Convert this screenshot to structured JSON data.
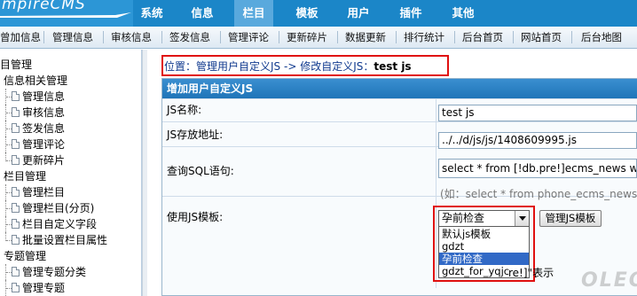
{
  "brand": {
    "logo_text": "mpireCMS"
  },
  "top_menu": [
    {
      "label": "系统"
    },
    {
      "label": "信息"
    },
    {
      "label": "栏目",
      "active": true
    },
    {
      "label": "模板"
    },
    {
      "label": "用户"
    },
    {
      "label": "插件"
    },
    {
      "label": "其他"
    }
  ],
  "toolbar": [
    {
      "label": "曾加信息"
    },
    {
      "label": "管理信息"
    },
    {
      "label": "审核信息"
    },
    {
      "label": "签发信息"
    },
    {
      "label": "管理评论"
    },
    {
      "label": "更新碎片"
    },
    {
      "label": "数据更新"
    },
    {
      "label": "排行统计"
    },
    {
      "label": "后台首页"
    },
    {
      "label": "网站首页"
    },
    {
      "label": "后台地图"
    }
  ],
  "sidebar": {
    "groups": [
      {
        "label": "目管理",
        "items": []
      },
      {
        "label": "信息相关管理",
        "items": [
          {
            "label": "管理信息"
          },
          {
            "label": "审核信息"
          },
          {
            "label": "签发信息"
          },
          {
            "label": "管理评论"
          },
          {
            "label": "更新碎片"
          }
        ]
      },
      {
        "label": "栏目管理",
        "items": [
          {
            "label": "管理栏目"
          },
          {
            "label": "管理栏目(分页)"
          },
          {
            "label": "栏目自定义字段"
          },
          {
            "label": "批量设置栏目属性"
          }
        ]
      },
      {
        "label": "专题管理",
        "items": [
          {
            "label": "管理专题分类"
          },
          {
            "label": "管理专题"
          }
        ]
      }
    ]
  },
  "breadcrumb": {
    "prefix": "位置：",
    "link1": "管理用户自定义JS",
    "arrow": " -> ",
    "link2": "修改自定义JS",
    "sep": "：",
    "current": "test js"
  },
  "form": {
    "heading": "增加用户自定义JS",
    "name_label": "JS名称:",
    "name_value": "test js",
    "path_label": "JS存放地址:",
    "path_value": "../../d/js/js/1408609995.js",
    "sql_label": "查询SQL语句:",
    "sql_value": "select *  from [!db.pre!]ecms_news whe",
    "sql_hint": "(如：select * from phone_ecms_news w",
    "template_label": "使用JS模板:",
    "template_selected": "孕前检查",
    "template_options": [
      "默认js模板",
      "gdzt",
      "孕前检查",
      "gdzt_for_yqjc"
    ],
    "manage_btn": "管理JS模板",
    "display_text": "re!]\"表示"
  },
  "watermark": "OLEOU",
  "colors": {
    "header": "#1b86c8",
    "form_head": "#1f74b8",
    "highlight": "#e01010",
    "selected_option": "#3169c6"
  }
}
